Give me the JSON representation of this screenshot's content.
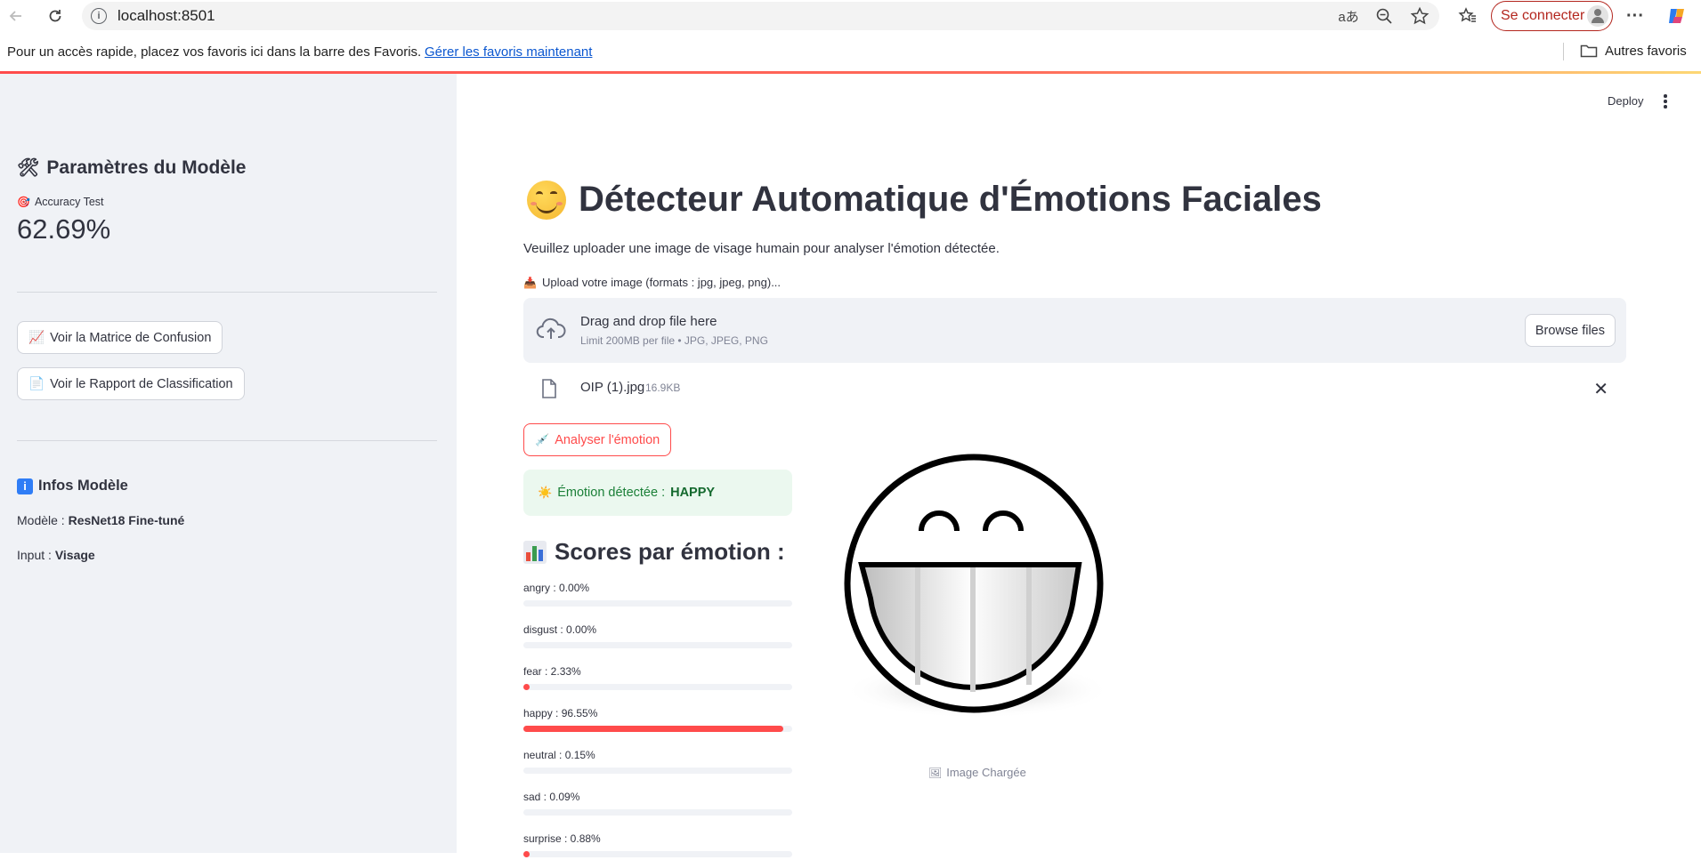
{
  "browser": {
    "url": "localhost:8501",
    "sign_in": "Se connecter",
    "fav_message": "Pour un accès rapide, placez vos favoris ici dans la barre des Favoris.",
    "fav_link": "Gérer les favoris maintenant",
    "other_favorites": "Autres favoris"
  },
  "sidebar": {
    "params_title": "Paramètres du Modèle",
    "metric_label": "Accuracy Test",
    "metric_value": "62.69%",
    "btn_confusion": "Voir la Matrice de Confusion",
    "btn_report": "Voir le Rapport de Classification",
    "info_title": "Infos Modèle",
    "model_label": "Modèle : ",
    "model_value": "ResNet18 Fine-tuné",
    "input_label": "Input : ",
    "input_value": "Visage"
  },
  "header": {
    "deploy": "Deploy"
  },
  "main": {
    "title": "Détecteur Automatique d'Émotions Faciales",
    "subtitle": "Veuillez uploader une image de visage humain pour analyser l'émotion détectée.",
    "upload_label": "Upload votre image (formats : jpg, jpeg, png)...",
    "drop_text": "Drag and drop file here",
    "drop_limit": "Limit 200MB per file • JPG, JPEG, PNG",
    "browse": "Browse files",
    "file_name": "OIP (1).jpg",
    "file_size": "16.9KB",
    "analyse_button": "Analyser l'émotion",
    "result_label": "Émotion détectée : ",
    "result_value": "HAPPY",
    "scores_title": "Scores par émotion :",
    "scores": [
      {
        "label": "angry : 0.00%",
        "value": 0.0
      },
      {
        "label": "disgust : 0.00%",
        "value": 0.0
      },
      {
        "label": "fear : 2.33%",
        "value": 2.33
      },
      {
        "label": "happy : 96.55%",
        "value": 96.55
      },
      {
        "label": "neutral : 0.15%",
        "value": 0.15
      },
      {
        "label": "sad : 0.09%",
        "value": 0.09
      },
      {
        "label": "surprise : 0.88%",
        "value": 0.88
      }
    ],
    "image_caption": "Image Chargée"
  },
  "colors": {
    "accent": "#ff4b4b",
    "sidebar_bg": "#f0f2f6",
    "success_bg": "#ebf8ef",
    "success_text": "#1a7f37"
  }
}
